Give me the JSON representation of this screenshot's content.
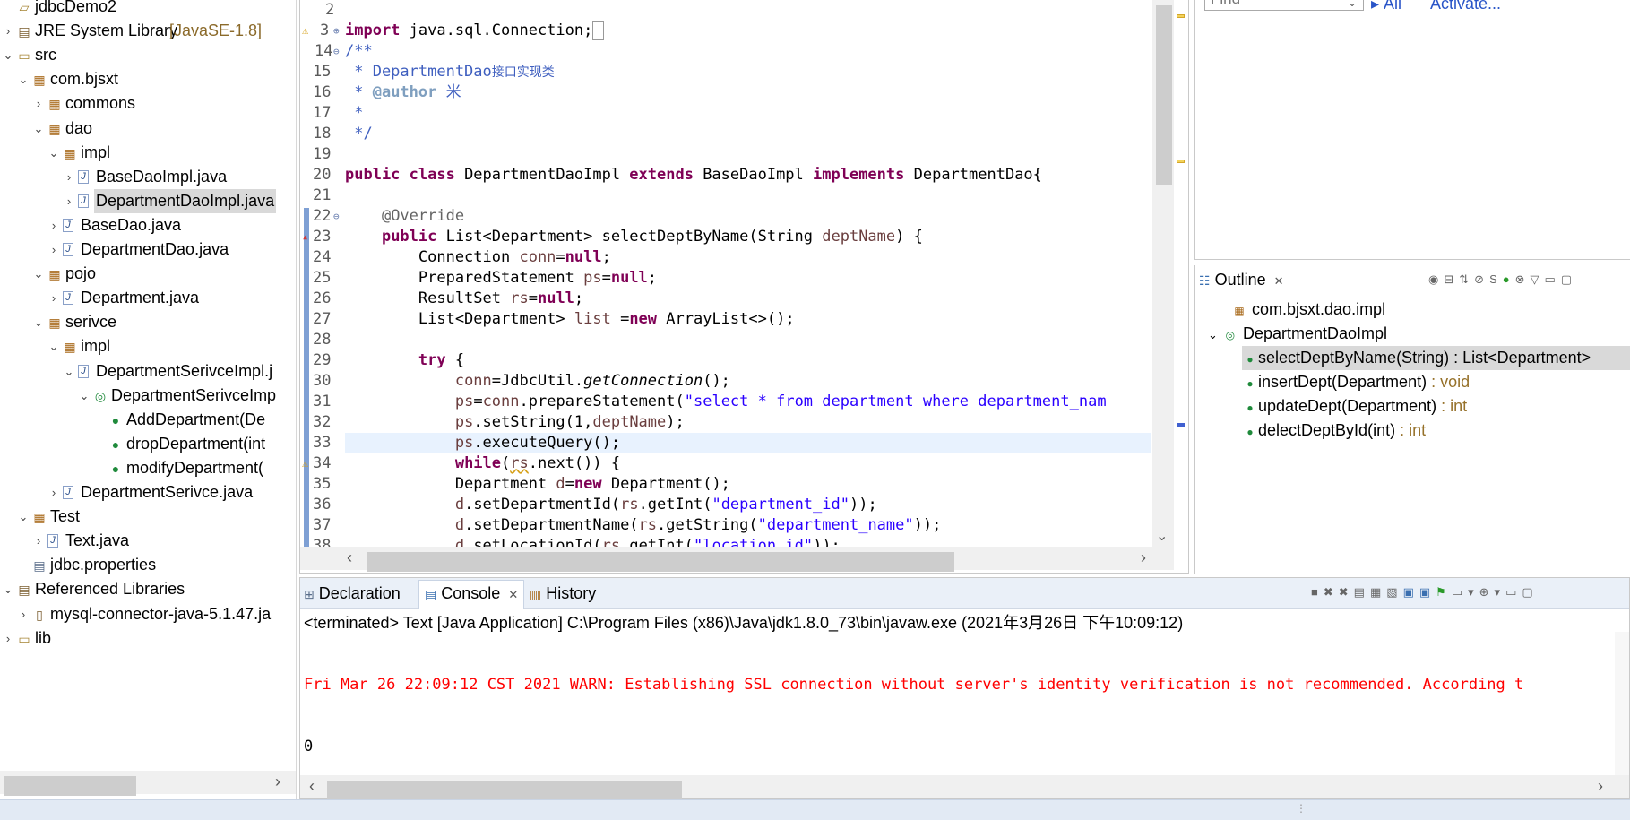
{
  "explorer": {
    "rows": [
      {
        "label": "jdbcDemo2",
        "decor": "",
        "arrow": "",
        "icon": "project"
      },
      {
        "label": "JRE System Library",
        "decor": "[JavaSE-1.8]",
        "arrow": "›",
        "icon": "library"
      },
      {
        "label": "src",
        "decor": "",
        "arrow": "⌄",
        "icon": "folder"
      },
      {
        "label": "com.bjsxt",
        "decor": "",
        "arrow": "⌄",
        "icon": "package"
      },
      {
        "label": "commons",
        "decor": "",
        "arrow": "›",
        "icon": "package"
      },
      {
        "label": "dao",
        "decor": "",
        "arrow": "⌄",
        "icon": "package"
      },
      {
        "label": "impl",
        "decor": "",
        "arrow": "⌄",
        "icon": "package"
      },
      {
        "label": "BaseDaoImpl.java",
        "decor": "",
        "arrow": "›",
        "icon": "java"
      },
      {
        "label": "DepartmentDaoImpl.java",
        "decor": "",
        "arrow": "›",
        "icon": "java"
      },
      {
        "label": "BaseDao.java",
        "decor": "",
        "arrow": "›",
        "icon": "java"
      },
      {
        "label": "DepartmentDao.java",
        "decor": "",
        "arrow": "›",
        "icon": "java"
      },
      {
        "label": "pojo",
        "decor": "",
        "arrow": "⌄",
        "icon": "package"
      },
      {
        "label": "Department.java",
        "decor": "",
        "arrow": "›",
        "icon": "java"
      },
      {
        "label": "serivce",
        "decor": "",
        "arrow": "⌄",
        "icon": "package"
      },
      {
        "label": "impl",
        "decor": "",
        "arrow": "⌄",
        "icon": "package"
      },
      {
        "label": "DepartmentSerivceImpl.j",
        "decor": "",
        "arrow": "⌄",
        "icon": "java"
      },
      {
        "label": "DepartmentSerivceImp",
        "decor": "",
        "arrow": "⌄",
        "icon": "class"
      },
      {
        "label": "AddDepartment(De",
        "decor": "",
        "arrow": "",
        "icon": "method"
      },
      {
        "label": "dropDepartment(int",
        "decor": "",
        "arrow": "",
        "icon": "method"
      },
      {
        "label": "modifyDepartment(",
        "decor": "",
        "arrow": "",
        "icon": "method"
      },
      {
        "label": "DepartmentSerivce.java",
        "decor": "",
        "arrow": "›",
        "icon": "java"
      },
      {
        "label": "Test",
        "decor": "",
        "arrow": "⌄",
        "icon": "package"
      },
      {
        "label": "Text.java",
        "decor": "",
        "arrow": "›",
        "icon": "java"
      },
      {
        "label": "jdbc.properties",
        "decor": "",
        "arrow": "",
        "icon": "properties"
      },
      {
        "label": "Referenced Libraries",
        "decor": "",
        "arrow": "⌄",
        "icon": "library"
      },
      {
        "label": "mysql-connector-java-5.1.47.ja",
        "decor": "",
        "arrow": "›",
        "icon": "jar"
      },
      {
        "label": "lib",
        "decor": "",
        "arrow": "›",
        "icon": "folder"
      }
    ]
  },
  "editor": {
    "line_numbers": [
      "2",
      "3",
      "14",
      "15",
      "16",
      "17",
      "18",
      "19",
      "20",
      "21",
      "22",
      "23",
      "24",
      "25",
      "26",
      "27",
      "28",
      "29",
      "30",
      "31",
      "32",
      "33",
      "34",
      "35",
      "36",
      "37",
      "38"
    ],
    "current_line": "33"
  },
  "tasklist": {
    "find_placeholder": "Find",
    "all_link": "All",
    "activate_link": "Activate..."
  },
  "outline": {
    "tab_label": "Outline",
    "package": "com.bjsxt.dao.impl",
    "class_name": "DepartmentDaoImpl",
    "members": [
      {
        "name": "selectDeptByName(String)",
        "ret": " : List<Department>"
      },
      {
        "name": "insertDept(Department)",
        "ret": " : void"
      },
      {
        "name": "updateDept(Department)",
        "ret": " : int"
      },
      {
        "name": "delectDeptById(int)",
        "ret": " : int"
      }
    ]
  },
  "console": {
    "tabs": [
      "Declaration",
      "Console",
      "History"
    ],
    "header": "<terminated> Text [Java Application] C:\\Program Files (x86)\\Java\\jdk1.8.0_73\\bin\\javaw.exe (2021年3月26日 下午10:09:12)",
    "warn_line": "Fri Mar 26 22:09:12 CST 2021 WARN: Establishing SSL connection without server's identity verification is not recommended. According t",
    "output_line": "0"
  }
}
